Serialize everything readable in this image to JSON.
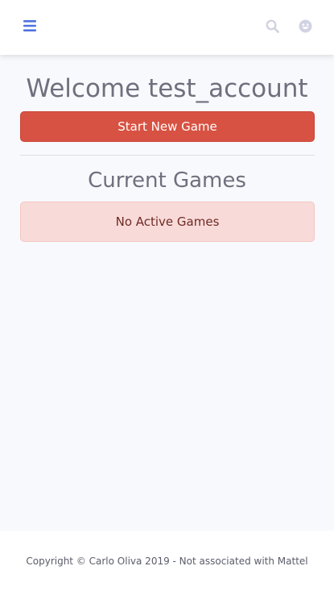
{
  "topbar": {
    "menu_icon": "hamburger-icon",
    "search_icon": "search-icon",
    "user_icon": "user-face-icon",
    "accent_color": "#4e73df",
    "muted_icon_color": "#d1d3e2"
  },
  "main": {
    "welcome_text": "Welcome test_account",
    "start_button_label": "Start New Game",
    "start_button_color": "#d75242",
    "current_games_title": "Current Games",
    "no_games_text": "No Active Games",
    "alert_color": "#f8dbd9"
  },
  "footer": {
    "copyright_text": "Copyright © Carlo Oliva 2019 - Not associated with Mattel"
  }
}
